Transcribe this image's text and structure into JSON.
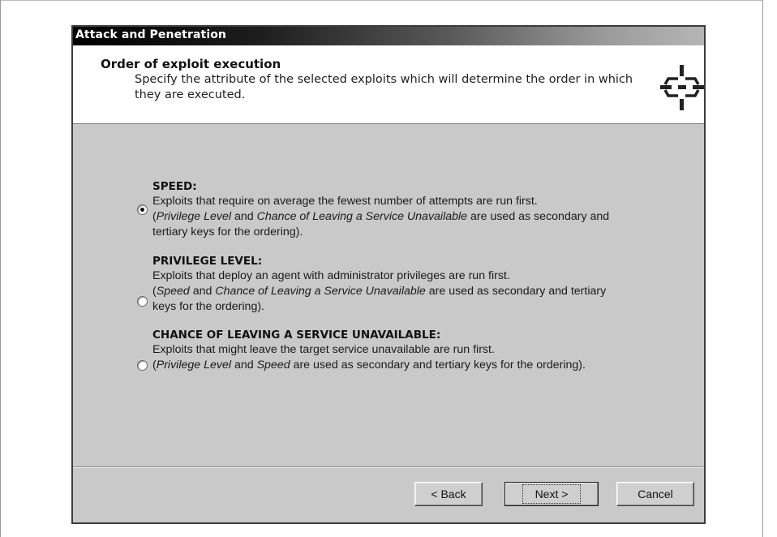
{
  "window": {
    "title": "Attack and Penetration"
  },
  "header": {
    "title": "Order of exploit execution",
    "subtitle": "Specify the attribute of the selected exploits which will determine the order in which they are executed.",
    "icon": "crosshair-target-icon"
  },
  "options": [
    {
      "label": "SPEED:",
      "checked": true,
      "line1": "Exploits that require on average the fewest number of attempts are run first.",
      "line2": [
        {
          "text": "(",
          "italic": false
        },
        {
          "text": "Privilege Level",
          "italic": true
        },
        {
          "text": " and ",
          "italic": false
        },
        {
          "text": "Chance of Leaving a Service Unavailable",
          "italic": true
        },
        {
          "text": " are used as secondary and",
          "italic": false
        }
      ],
      "line3": "tertiary keys for the ordering)."
    },
    {
      "label": "PRIVILEGE LEVEL:",
      "checked": false,
      "line1": "Exploits that deploy an agent with administrator privileges are run first.",
      "line2": [
        {
          "text": "(",
          "italic": false
        },
        {
          "text": "Speed",
          "italic": true
        },
        {
          "text": " and ",
          "italic": false
        },
        {
          "text": "Chance of Leaving a Service Unavailable",
          "italic": true
        },
        {
          "text": " are used as secondary and tertiary",
          "italic": false
        }
      ],
      "line3": "keys for the ordering)."
    },
    {
      "label": "CHANCE OF LEAVING A SERVICE UNAVAILABLE:",
      "checked": false,
      "line1": "Exploits that might leave the target service unavailable are run first.",
      "line2": [
        {
          "text": "(",
          "italic": false
        },
        {
          "text": "Privilege Level",
          "italic": true
        },
        {
          "text": " and ",
          "italic": false
        },
        {
          "text": "Speed",
          "italic": true
        },
        {
          "text": " are used as secondary and tertiary keys for the ordering).",
          "italic": false
        }
      ],
      "line3": ""
    }
  ],
  "buttons": {
    "back": "< Back",
    "next": "Next >",
    "cancel": "Cancel"
  }
}
